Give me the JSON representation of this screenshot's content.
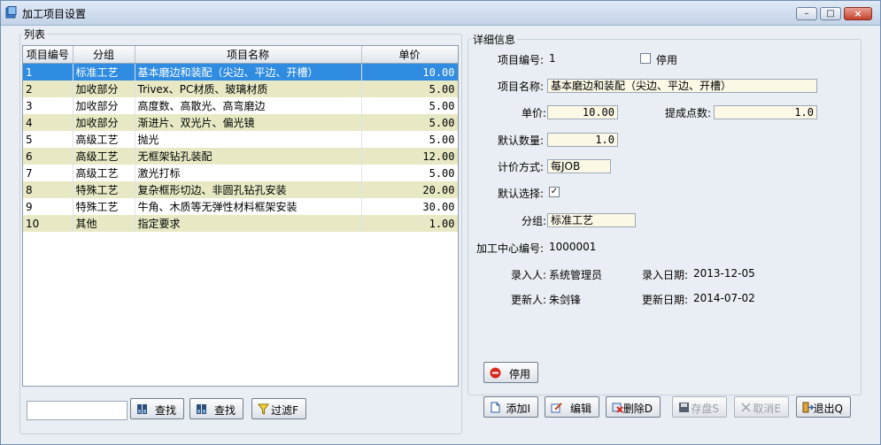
{
  "window": {
    "title": "加工项目设置",
    "minimize": "–",
    "maximize": "□",
    "close": "×"
  },
  "list": {
    "group_label": "列表",
    "columns": [
      "项目编号",
      "分组",
      "项目名称",
      "单价"
    ],
    "rows": [
      {
        "id": "1",
        "group": "标准工艺",
        "name": "基本磨边和装配（尖边、平边、开槽）",
        "price": "10.00"
      },
      {
        "id": "2",
        "group": "加收部分",
        "name": "Trivex、PC材质、玻璃材质",
        "price": "5.00"
      },
      {
        "id": "3",
        "group": "加收部分",
        "name": "高度数、高散光、高弯磨边",
        "price": "5.00"
      },
      {
        "id": "4",
        "group": "加收部分",
        "name": "渐进片、双光片、偏光镜",
        "price": "5.00"
      },
      {
        "id": "5",
        "group": "高级工艺",
        "name": "抛光",
        "price": "5.00"
      },
      {
        "id": "6",
        "group": "高级工艺",
        "name": "无框架钻孔装配",
        "price": "12.00"
      },
      {
        "id": "7",
        "group": "高级工艺",
        "name": "激光打标",
        "price": "5.00"
      },
      {
        "id": "8",
        "group": "特殊工艺",
        "name": "复杂框形切边、非圆孔钻孔安装",
        "price": "20.00"
      },
      {
        "id": "9",
        "group": "特殊工艺",
        "name": "牛角、木质等无弹性材料框架安装",
        "price": "30.00"
      },
      {
        "id": "10",
        "group": "其他",
        "name": "指定要求",
        "price": "1.00"
      }
    ],
    "search_value": "",
    "find_button_1": "查找",
    "find_button_2": "查找",
    "filter_button": "过滤F"
  },
  "detail": {
    "group_label": "详细信息",
    "item_no_label": "项目编号:",
    "item_no_value": "1",
    "disabled_label": "停用",
    "item_name_label": "项目名称:",
    "item_name_value": "基本磨边和装配（尖边、平边、开槽）",
    "price_label": "单价:",
    "price_value": "10.00",
    "points_label": "提成点数:",
    "points_value": "1.0",
    "default_qty_label": "默认数量:",
    "default_qty_value": "1.0",
    "pricing_label": "计价方式:",
    "pricing_value": "每JOB",
    "default_select_label": "默认选择:",
    "default_select_mark": "✓",
    "group_label2": "分组:",
    "group_value": "标准工艺",
    "center_no_label": "加工中心编号:",
    "center_no_value": "1000001",
    "entered_by_label": "录入人:",
    "entered_by_value": "系统管理员",
    "entered_date_label": "录入日期:",
    "entered_date_value": "2013-12-05",
    "updated_by_label": "更新人:",
    "updated_by_value": "朱剑锋",
    "updated_date_label": "更新日期:",
    "updated_date_value": "2014-07-02"
  },
  "actions": {
    "stop": "停用",
    "add": "添加I",
    "edit": "编辑",
    "delete": "删除D",
    "save": "存盘S",
    "cancel": "取消E",
    "exit": "退出Q"
  },
  "colors": {
    "selected_row": "#2f8ce0",
    "alt_row": "#e8e9c4",
    "field_bg": "#fbf8e6"
  }
}
